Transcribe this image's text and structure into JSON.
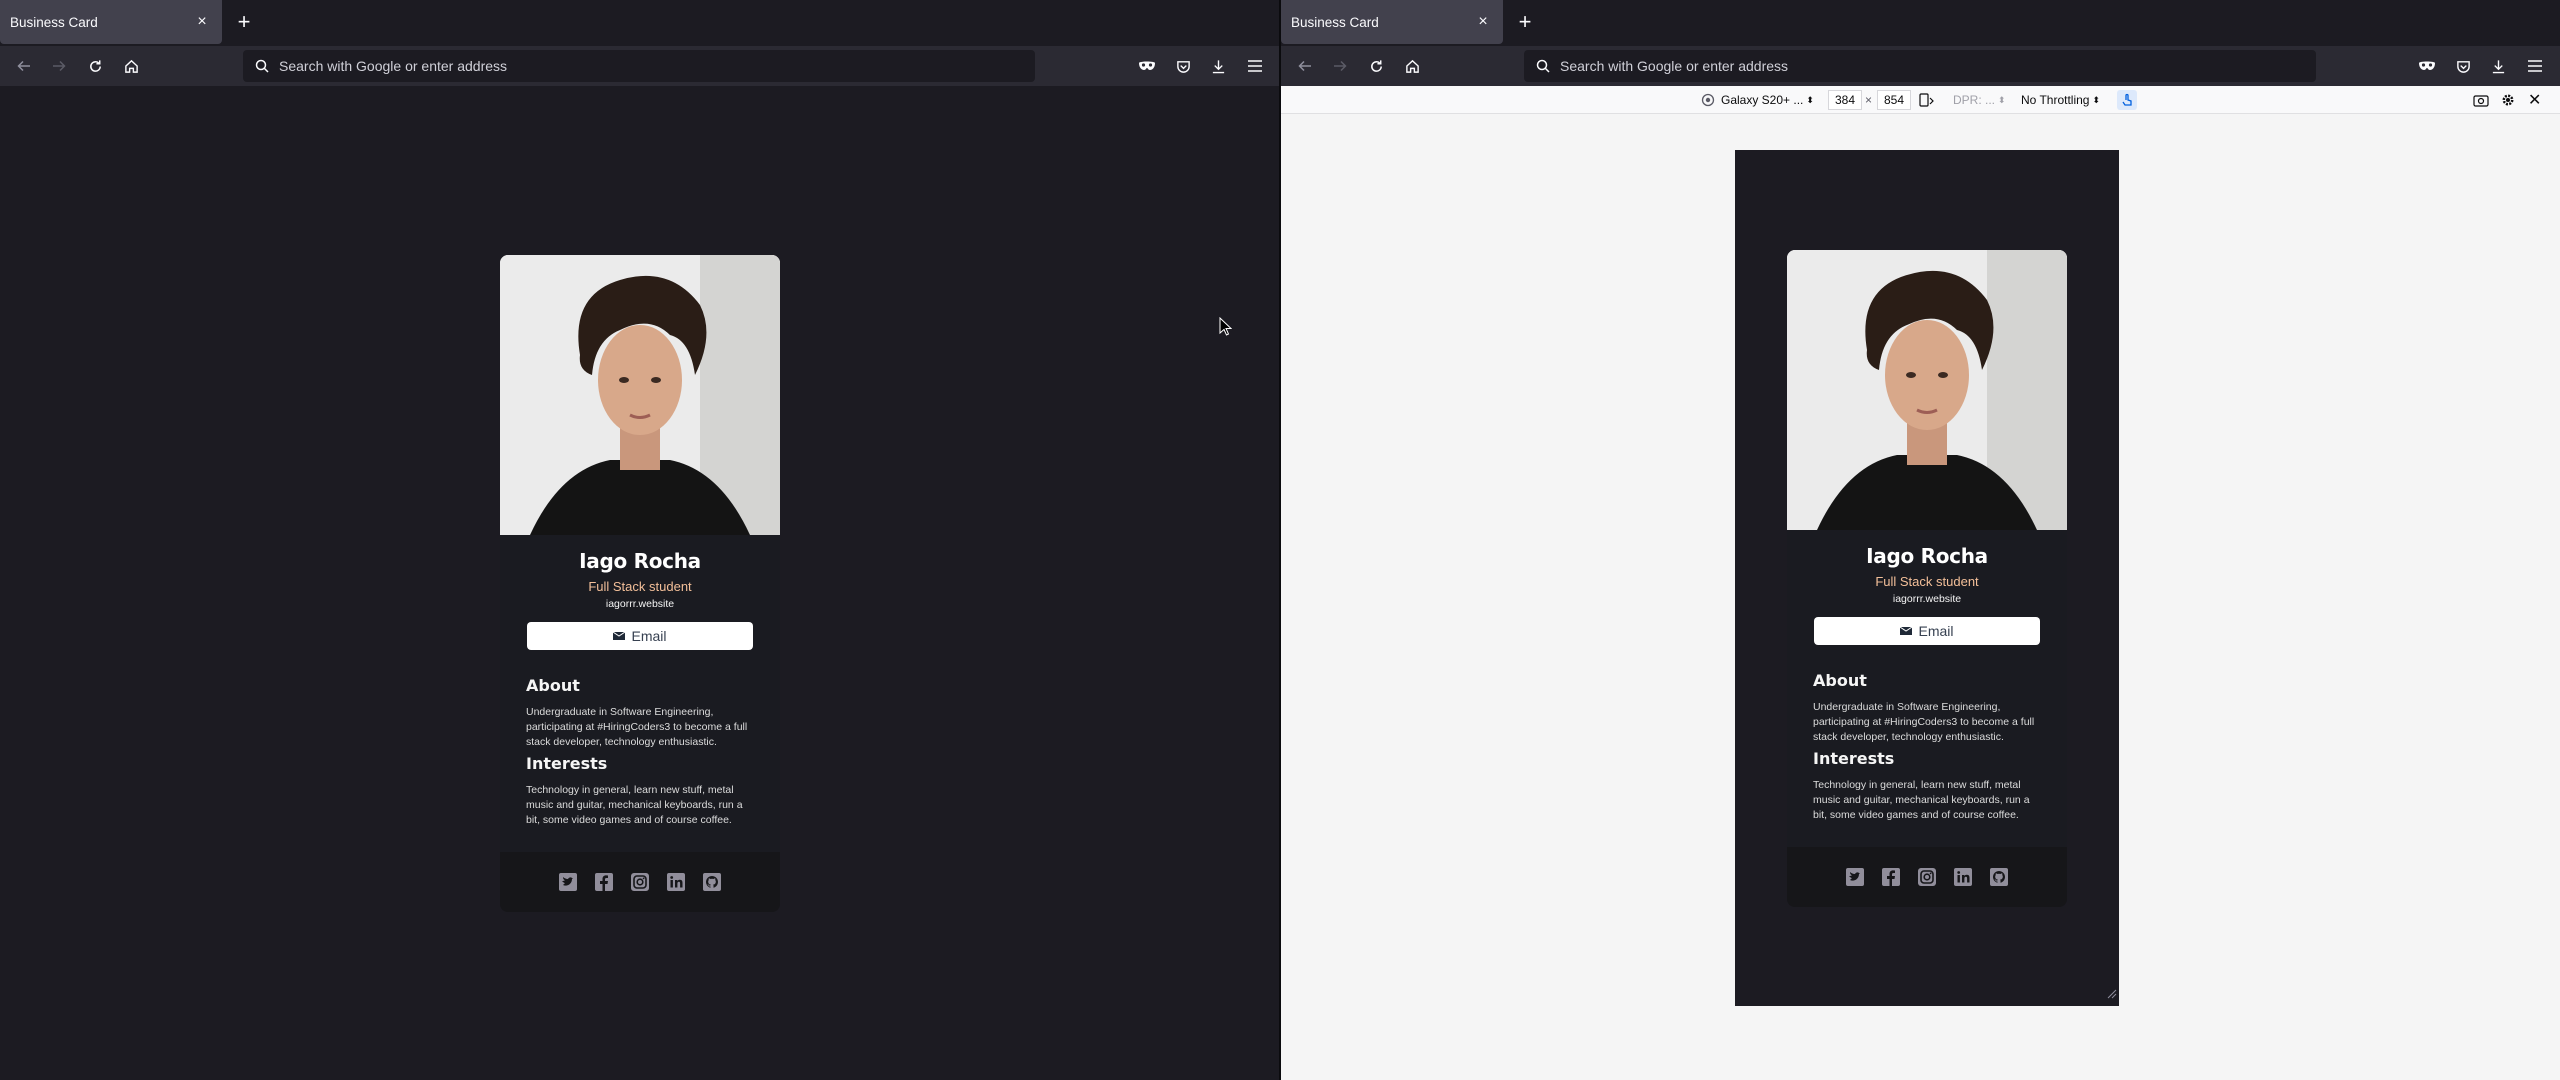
{
  "windows": [
    {
      "tab_title": "Business Card",
      "address_placeholder": "Search with Google or enter address"
    },
    {
      "tab_title": "Business Card",
      "address_placeholder": "Search with Google or enter address"
    }
  ],
  "rdm": {
    "device": "Galaxy S20+ ...",
    "width": "384",
    "times": "×",
    "height": "854",
    "dpr": "DPR: ...",
    "throttling": "No Throttling"
  },
  "card": {
    "name": "Iago Rocha",
    "role": "Full Stack student",
    "website": "iagorrr.website",
    "email_label": "Email",
    "about_title": "About",
    "about_text": "Undergraduate in Software Engineering, participating at #HiringCoders3 to become a full stack developer, technology enthusiastic.",
    "interests_title": "Interests",
    "interests_text": "Technology in general, learn new stuff, metal music and guitar, mechanical keyboards, run a bit, some video games and of course coffee."
  },
  "social_icons": [
    "twitter-icon",
    "facebook-icon",
    "instagram-icon",
    "linkedin-icon",
    "github-icon"
  ],
  "colors": {
    "accent_role": "#f3bf99",
    "card_bg": "#1a1b21",
    "page_bg": "#1c1b22"
  }
}
